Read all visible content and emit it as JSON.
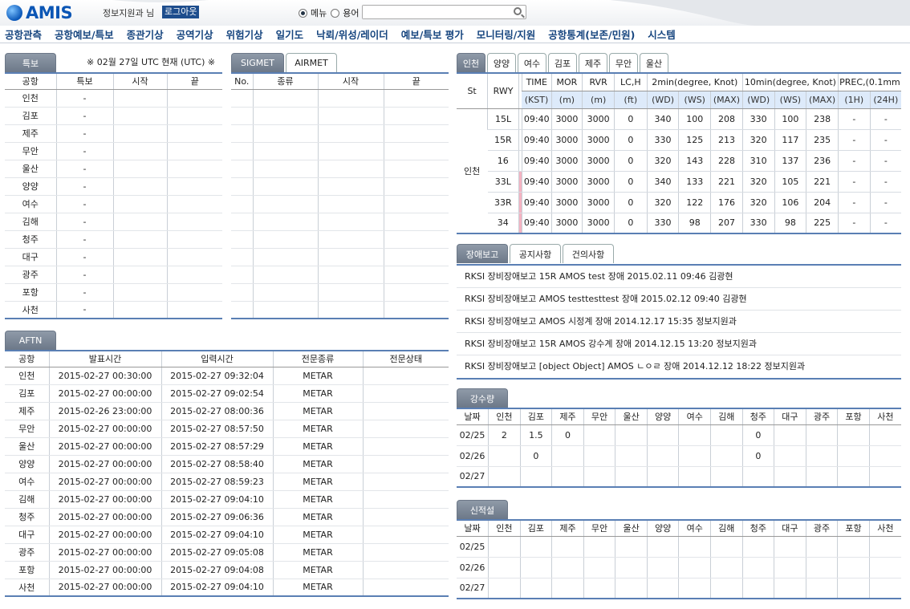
{
  "app": {
    "logo": "AMIS",
    "user": "정보지원과 님",
    "logout": "로그아웃",
    "radio_menu": "메뉴",
    "radio_term": "용어",
    "search_value": ""
  },
  "nav": [
    "공항관측",
    "공항예보/특보",
    "종관기상",
    "공역기상",
    "위험기상",
    "일기도",
    "낙뢰/위성/레이더",
    "예보/특보 평가",
    "모니터링/지원",
    "공항통계(보존/민원)",
    "시스템"
  ],
  "warn": {
    "tab": "특보",
    "time": "※ 02월 27일 UTC 현재 (UTC) ※",
    "cols": [
      "공항",
      "특보",
      "시작",
      "끝"
    ],
    "rows": [
      [
        "인천",
        "-",
        "",
        ""
      ],
      [
        "김포",
        "-",
        "",
        ""
      ],
      [
        "제주",
        "-",
        "",
        ""
      ],
      [
        "무안",
        "-",
        "",
        ""
      ],
      [
        "울산",
        "-",
        "",
        ""
      ],
      [
        "양양",
        "-",
        "",
        ""
      ],
      [
        "여수",
        "-",
        "",
        ""
      ],
      [
        "김해",
        "-",
        "",
        ""
      ],
      [
        "청주",
        "-",
        "",
        ""
      ],
      [
        "대구",
        "-",
        "",
        ""
      ],
      [
        "광주",
        "-",
        "",
        ""
      ],
      [
        "포항",
        "-",
        "",
        ""
      ],
      [
        "사천",
        "-",
        "",
        ""
      ]
    ]
  },
  "sigmet": {
    "tabs": [
      "SIGMET",
      "AIRMET"
    ],
    "cols": [
      "No.",
      "종류",
      "시작",
      "끝"
    ]
  },
  "aftn": {
    "tab": "AFTN",
    "cols": [
      "공항",
      "발표시간",
      "입력시간",
      "전문종류",
      "전문상태"
    ],
    "rows": [
      [
        "인천",
        "2015-02-27 00:30:00",
        "2015-02-27 09:32:04",
        "METAR",
        ""
      ],
      [
        "김포",
        "2015-02-27 00:00:00",
        "2015-02-27 09:02:54",
        "METAR",
        ""
      ],
      [
        "제주",
        "2015-02-26 23:00:00",
        "2015-02-27 08:00:36",
        "METAR",
        ""
      ],
      [
        "무안",
        "2015-02-27 00:00:00",
        "2015-02-27 08:57:50",
        "METAR",
        ""
      ],
      [
        "울산",
        "2015-02-27 00:00:00",
        "2015-02-27 08:57:29",
        "METAR",
        ""
      ],
      [
        "양양",
        "2015-02-27 00:00:00",
        "2015-02-27 08:58:40",
        "METAR",
        ""
      ],
      [
        "여수",
        "2015-02-27 00:00:00",
        "2015-02-27 08:59:23",
        "METAR",
        ""
      ],
      [
        "김해",
        "2015-02-27 00:00:00",
        "2015-02-27 09:04:10",
        "METAR",
        ""
      ],
      [
        "청주",
        "2015-02-27 00:00:00",
        "2015-02-27 09:06:36",
        "METAR",
        ""
      ],
      [
        "대구",
        "2015-02-27 00:00:00",
        "2015-02-27 09:04:10",
        "METAR",
        ""
      ],
      [
        "광주",
        "2015-02-27 00:00:00",
        "2015-02-27 09:05:08",
        "METAR",
        ""
      ],
      [
        "포항",
        "2015-02-27 00:00:00",
        "2015-02-27 09:04:08",
        "METAR",
        ""
      ],
      [
        "사천",
        "2015-02-27 00:00:00",
        "2015-02-27 09:04:10",
        "METAR",
        ""
      ]
    ]
  },
  "wx": {
    "tabs": [
      "인천",
      "양양",
      "여수",
      "김포",
      "제주",
      "무안",
      "울산"
    ],
    "h1": [
      "St",
      "RWY",
      "TIME",
      "MOR",
      "RVR",
      "LC,H",
      "2min(degree, Knot)",
      "10min(degree, Knot)",
      "PREC,(0.1mm"
    ],
    "h2": [
      "(KST)",
      "(m)",
      "(m)",
      "(ft)",
      "(WD)",
      "(WS)",
      "(MAX)",
      "(WD)",
      "(WS)",
      "(MAX)",
      "(1H)",
      "(24H)"
    ],
    "station": "인천",
    "rows": [
      [
        "15L",
        "09:40",
        "3000",
        "3000",
        "0",
        "340",
        "100",
        "208",
        "330",
        "100",
        "238",
        "-",
        "-"
      ],
      [
        "15R",
        "09:40",
        "3000",
        "3000",
        "0",
        "330",
        "125",
        "213",
        "320",
        "117",
        "235",
        "-",
        "-"
      ],
      [
        "16",
        "09:40",
        "3000",
        "3000",
        "0",
        "320",
        "143",
        "228",
        "310",
        "137",
        "236",
        "-",
        "-"
      ],
      [
        "33L",
        "09:40",
        "3000",
        "3000",
        "0",
        "340",
        "133",
        "221",
        "320",
        "105",
        "221",
        "-",
        "-"
      ],
      [
        "33R",
        "09:40",
        "3000",
        "3000",
        "0",
        "320",
        "122",
        "176",
        "320",
        "106",
        "204",
        "-",
        "-"
      ],
      [
        "34",
        "09:40",
        "3000",
        "3000",
        "0",
        "330",
        "98",
        "207",
        "330",
        "98",
        "225",
        "-",
        "-"
      ]
    ],
    "pink_rows": [
      3,
      4,
      5
    ]
  },
  "notice": {
    "tabs": [
      "장애보고",
      "공지사항",
      "건의사항"
    ],
    "items": [
      "RKSI 장비장애보고 15R AMOS test 장애 2015.02.11 09:46 김광현",
      "RKSI 장비장애보고 AMOS testtesttest 장애 2015.02.12 09:40 김광현",
      "RKSI 장비장애보고 AMOS 시정계 장애 2014.12.17 15:35 정보지원과",
      "RKSI 장비장애보고 15R AMOS 강수계 장애 2014.12.15 13:20 정보지원과",
      "RKSI 장비장애보고 [object Object] AMOS ㄴㅇㄹ 장애 2014.12.12 18:22 정보지원과"
    ]
  },
  "rain": {
    "tab": "강수량",
    "cols": [
      "날짜",
      "인천",
      "김포",
      "제주",
      "무안",
      "울산",
      "양양",
      "여수",
      "김해",
      "청주",
      "대구",
      "광주",
      "포항",
      "사천"
    ],
    "rows": [
      [
        "02/25",
        "2",
        "1.5",
        "0",
        "",
        "",
        "",
        "",
        "",
        "0",
        "",
        "",
        "",
        ""
      ],
      [
        "02/26",
        "",
        "0",
        "",
        "",
        "",
        "",
        "",
        "",
        "0",
        "",
        "",
        "",
        ""
      ],
      [
        "02/27",
        "",
        "",
        "",
        "",
        "",
        "",
        "",
        "",
        "",
        "",
        "",
        "",
        ""
      ]
    ]
  },
  "snow": {
    "tab": "신적설",
    "cols": [
      "날짜",
      "인천",
      "김포",
      "제주",
      "무안",
      "울산",
      "양양",
      "여수",
      "김해",
      "청주",
      "대구",
      "광주",
      "포항",
      "사천"
    ],
    "rows": [
      [
        "02/25",
        "",
        "",
        "",
        "",
        "",
        "",
        "",
        "",
        "",
        "",
        "",
        "",
        ""
      ],
      [
        "02/26",
        "",
        "",
        "",
        "",
        "",
        "",
        "",
        "",
        "",
        "",
        "",
        "",
        ""
      ],
      [
        "02/27",
        "",
        "",
        "",
        "",
        "",
        "",
        "",
        "",
        "",
        "",
        "",
        "",
        ""
      ]
    ]
  }
}
